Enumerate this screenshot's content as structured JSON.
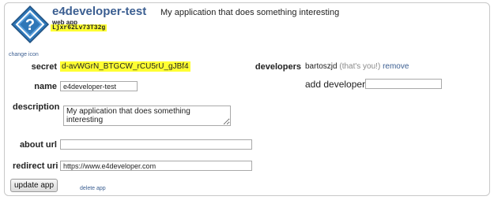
{
  "app": {
    "name": "e4developer-test",
    "type": "web app",
    "id": "Ljxr62Lv73T32g",
    "description_header": "My application that does something interesting",
    "icon": "question-mark-diamond-icon",
    "change_icon_label": "change icon"
  },
  "form": {
    "secret_label": "secret",
    "secret_value": "d-avWGrN_BTGCW_rCU5rU_gJBf4",
    "name_label": "name",
    "name_value": "e4developer-test",
    "description_label": "description",
    "description_value": "My application that does something interesting",
    "about_url_label": "about url",
    "about_url_value": "",
    "redirect_uri_label": "redirect uri",
    "redirect_uri_value": "https://www.e4developer.com",
    "update_button": "update app",
    "delete_link": "delete app"
  },
  "developers": {
    "label": "developers",
    "list": [
      {
        "name": "bartoszjd",
        "note": "(that's you!)",
        "action": "remove"
      }
    ],
    "add_label": "add developer:",
    "add_value": ""
  },
  "colors": {
    "highlight": "#ffff33",
    "link": "#3b5e91",
    "icon_blue": "#2f77b7"
  }
}
